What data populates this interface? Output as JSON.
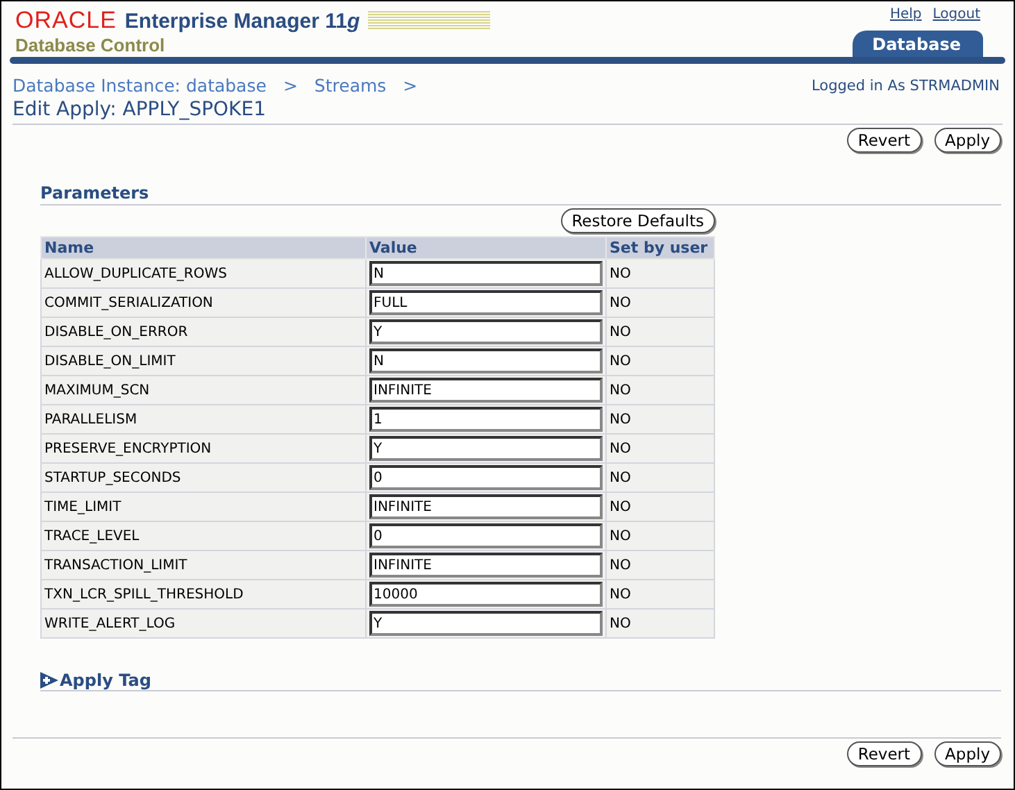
{
  "header": {
    "brand": "ORACLE",
    "product": "Enterprise Manager 11",
    "product_suffix": "g",
    "subtitle": "Database Control",
    "links": [
      "Help",
      "Logout"
    ],
    "tab": {
      "label": "Database",
      "selected": true
    }
  },
  "breadcrumbs": [
    "Database Instance: database",
    "Streams"
  ],
  "breadcrumb_separator": ">",
  "login": "Logged in As STRMADMIN",
  "page_title": "Edit Apply: APPLY_SPOKE1",
  "top_buttons": [
    "Revert",
    "Apply"
  ],
  "parameters": {
    "title": "Parameters",
    "restore_button": "Restore Defaults",
    "columns": [
      "Name",
      "Value",
      "Set by user"
    ],
    "rows": [
      {
        "name": "ALLOW_DUPLICATE_ROWS",
        "value": "N",
        "set_by_user": "NO"
      },
      {
        "name": "COMMIT_SERIALIZATION",
        "value": "FULL",
        "set_by_user": "NO"
      },
      {
        "name": "DISABLE_ON_ERROR",
        "value": "Y",
        "set_by_user": "NO"
      },
      {
        "name": "DISABLE_ON_LIMIT",
        "value": "N",
        "set_by_user": "NO"
      },
      {
        "name": "MAXIMUM_SCN",
        "value": "INFINITE",
        "set_by_user": "NO"
      },
      {
        "name": "PARALLELISM",
        "value": "1",
        "set_by_user": "NO"
      },
      {
        "name": "PRESERVE_ENCRYPTION",
        "value": "Y",
        "set_by_user": "NO"
      },
      {
        "name": "STARTUP_SECONDS",
        "value": "0",
        "set_by_user": "NO"
      },
      {
        "name": "TIME_LIMIT",
        "value": "INFINITE",
        "set_by_user": "NO"
      },
      {
        "name": "TRACE_LEVEL",
        "value": "0",
        "set_by_user": "NO"
      },
      {
        "name": "TRANSACTION_LIMIT",
        "value": "INFINITE",
        "set_by_user": "NO"
      },
      {
        "name": "TXN_LCR_SPILL_THRESHOLD",
        "value": "10000",
        "set_by_user": "NO"
      },
      {
        "name": "WRITE_ALERT_LOG",
        "value": "Y",
        "set_by_user": "NO"
      }
    ]
  },
  "apply_tag": {
    "title": "Apply Tag",
    "expanded": false
  },
  "bottom_buttons": [
    "Revert",
    "Apply"
  ]
}
